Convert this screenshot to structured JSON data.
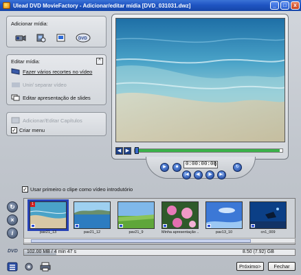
{
  "window": {
    "title": "Ulead DVD MovieFactory - Adicionar/editar mídia [DVD_031031.dwz]",
    "minimize": "_",
    "restore": "□",
    "close": "x"
  },
  "add_media": {
    "title": "Adicionar mídia:",
    "icons": [
      "camcorder-icon",
      "dvd-camcorder-icon",
      "video-file-icon",
      "dvd-disc-icon"
    ]
  },
  "edit_media": {
    "title": "Editar mídia:",
    "collapse": "^",
    "items": [
      {
        "label": "Fazer vários recortes no vídeo",
        "underline_char": "F",
        "enabled": true
      },
      {
        "label": "Unir/ separar vídeo",
        "enabled": false
      },
      {
        "label": "Editar apresentação de slides",
        "enabled": true
      }
    ]
  },
  "chapters": {
    "add_edit_label": "Adicionar/Editar Capítulos",
    "create_menu_label": "Criar menu",
    "create_menu_checked": true
  },
  "player": {
    "timecode": "0:00:00:00",
    "check": "✓",
    "prev": "◀",
    "next": "▶",
    "progress": 0.0
  },
  "intro_checkbox": {
    "label": "Usar primeiro o clipe como vídeo introdutório",
    "checked": true
  },
  "clips": [
    {
      "label": "pav21_13",
      "selected": true,
      "number": "1",
      "scene": "beach-water"
    },
    {
      "label": "pav21_12",
      "selected": false,
      "scene": "sea-bay"
    },
    {
      "label": "pav21_9",
      "selected": false,
      "scene": "green-field"
    },
    {
      "label": "Minha apresentação ...",
      "selected": false,
      "scene": "pink-flowers"
    },
    {
      "label": "pav13_10",
      "selected": false,
      "scene": "blue-sky"
    },
    {
      "label": "cn1_009",
      "selected": false,
      "scene": "underwater-diver"
    }
  ],
  "disc_usage": {
    "disc_icon_label": "DVD",
    "used": "102.00 MB / 4 min 47 s",
    "capacity": "8.50 (7.92) GB",
    "fraction": 0.012
  },
  "buttons": {
    "next": "Próximo>",
    "close": "Fechar"
  },
  "colors": {
    "titlebar": "#1f55c3",
    "selection": "#2742b6"
  }
}
